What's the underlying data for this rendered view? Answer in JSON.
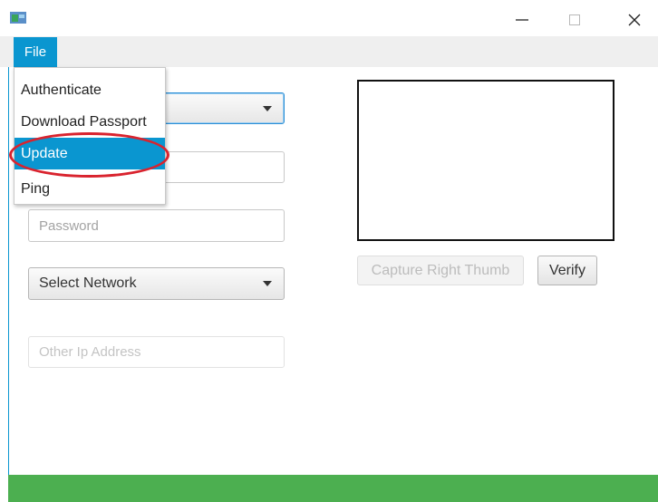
{
  "window": {
    "icon": "app-window-icon",
    "controls": {
      "minimize_icon": "minimize-icon",
      "maximize_icon": "maximize-icon",
      "close_icon": "close-icon"
    }
  },
  "menubar": {
    "file_label": "File"
  },
  "file_menu": {
    "items": [
      {
        "label": "Authenticate"
      },
      {
        "label": "Download Passport"
      },
      {
        "label": "Update",
        "selected": true
      },
      {
        "label": "Ping"
      }
    ]
  },
  "form": {
    "password_placeholder": "Password",
    "network_select": {
      "selected": "Select Network"
    },
    "other_ip_placeholder": "Other Ip Address"
  },
  "fingerprint": {
    "capture_label": "Capture Right Thumb",
    "verify_label": "Verify"
  },
  "colors": {
    "accent": "#0a96d0",
    "status_bar": "#4caf50",
    "annotation": "#d9232e"
  }
}
